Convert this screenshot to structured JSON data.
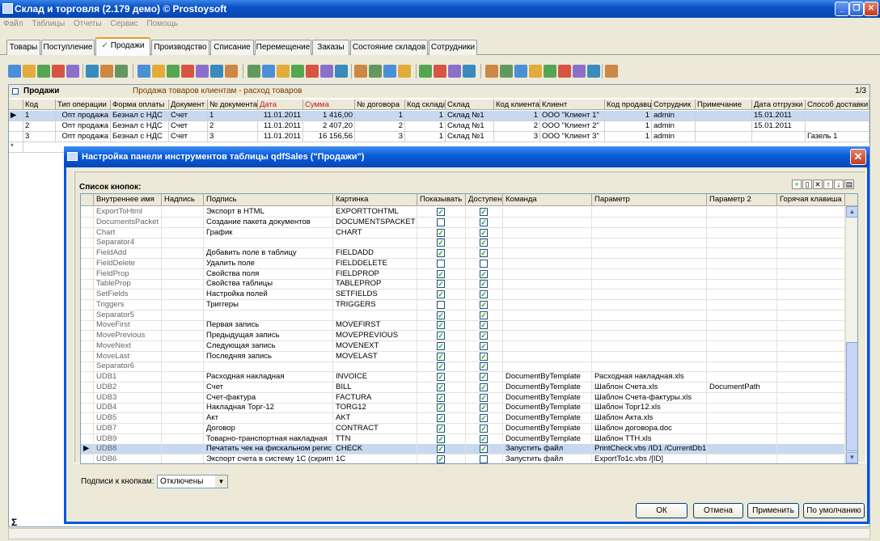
{
  "window": {
    "title": "Склад и торговля (2.179 демо) © Prostoysoft"
  },
  "menu": [
    "Файл",
    "Таблицы",
    "Отчеты",
    "Сервис",
    "Помощь"
  ],
  "tabs": [
    "Товары",
    "Поступление",
    "Продажи",
    "Производство",
    "Списание",
    "Перемещение",
    "Заказы",
    "Состояние складов",
    "Сотрудники"
  ],
  "active_tab_mark": "✓",
  "panel": {
    "title": "Продажи",
    "description": "Продажа товаров клиентам - расход товаров",
    "page": "1/3"
  },
  "main_table": {
    "columns": [
      "Код",
      "Тип операции",
      "Форма оплаты",
      "Документ",
      "№ документа",
      "Дата",
      "Сумма",
      "№ договора",
      "Код склада",
      "Склад",
      "Код клиента",
      "Клиент",
      "Код продавца",
      "Сотрудник",
      "Примечание",
      "Дата отгрузки",
      "Способ доставки"
    ],
    "rows": [
      [
        "1",
        "Опт продажа",
        "Безнал с НДС",
        "Счет",
        "1",
        "11.01.2011",
        "1 416,00",
        "1",
        "1",
        "Склад №1",
        "1",
        "ООО \"Клиент 1\"",
        "1",
        "admin",
        "",
        "15.01.2011",
        ""
      ],
      [
        "2",
        "Опт продажа",
        "Безнал с НДС",
        "Счет",
        "2",
        "11.01.2011",
        "2 407,20",
        "2",
        "1",
        "Склад №1",
        "2",
        "ООО \"Клиент 2\"",
        "1",
        "admin",
        "",
        "15.01.2011",
        ""
      ],
      [
        "3",
        "Опт продажа",
        "Безнал с НДС",
        "Счет",
        "3",
        "11.01.2011",
        "16 156,56",
        "3",
        "1",
        "Склад №1",
        "3",
        "ООО \"Клиент 3\"",
        "1",
        "admin",
        "",
        "",
        "Газель 1"
      ]
    ],
    "new_row_marker": "*",
    "sum_marker": "Σ"
  },
  "dialog": {
    "title": "Настройка панели инструментов таблицы qdfSales (\"Продажи\")",
    "list_label": "Список кнопок:",
    "columns": [
      "Внутреннее имя",
      "Надпись",
      "Подпись",
      "Картинка",
      "Показывать",
      "Доступен",
      "Команда",
      "Параметр",
      "Параметр 2",
      "Горячая клавиша"
    ],
    "rows": [
      {
        "name": "ExportToHtml",
        "caption": "",
        "hint": "Экспорт в HTML",
        "image": "EXPORTTOHTML",
        "show": true,
        "enabled": true,
        "command": "",
        "param": "",
        "param2": ""
      },
      {
        "name": "DocumentsPacket",
        "caption": "",
        "hint": "Создание пакета документов",
        "image": "DOCUMENTSPACKET",
        "show": false,
        "enabled": true,
        "command": "",
        "param": "",
        "param2": ""
      },
      {
        "name": "Chart",
        "caption": "",
        "hint": "График",
        "image": "CHART",
        "show": true,
        "enabled": true,
        "command": "",
        "param": "",
        "param2": ""
      },
      {
        "name": "Separator4",
        "caption": "",
        "hint": "",
        "image": "",
        "show": true,
        "enabled": true,
        "command": "",
        "param": "",
        "param2": ""
      },
      {
        "name": "FieldAdd",
        "caption": "",
        "hint": "Добавить поле в таблицу",
        "image": "FIELDADD",
        "show": true,
        "enabled": true,
        "command": "",
        "param": "",
        "param2": ""
      },
      {
        "name": "FieldDelete",
        "caption": "",
        "hint": "Удалить поле",
        "image": "FIELDDELETE",
        "show": false,
        "enabled": false,
        "command": "",
        "param": "",
        "param2": ""
      },
      {
        "name": "FieldProp",
        "caption": "",
        "hint": "Свойства поля",
        "image": "FIELDPROP",
        "show": true,
        "enabled": true,
        "command": "",
        "param": "",
        "param2": ""
      },
      {
        "name": "TableProp",
        "caption": "",
        "hint": "Свойства таблицы",
        "image": "TABLEPROP",
        "show": true,
        "enabled": true,
        "command": "",
        "param": "",
        "param2": ""
      },
      {
        "name": "SetFields",
        "caption": "",
        "hint": "Настройка полей",
        "image": "SETFIELDS",
        "show": true,
        "enabled": true,
        "command": "",
        "param": "",
        "param2": ""
      },
      {
        "name": "Triggers",
        "caption": "",
        "hint": "Триггеры",
        "image": "TRIGGERS",
        "show": false,
        "enabled": true,
        "command": "",
        "param": "",
        "param2": ""
      },
      {
        "name": "Separator5",
        "caption": "",
        "hint": "",
        "image": "",
        "show": true,
        "enabled": true,
        "command": "",
        "param": "",
        "param2": ""
      },
      {
        "name": "MoveFirst",
        "caption": "",
        "hint": "Первая запись",
        "image": "MOVEFIRST",
        "show": true,
        "enabled": true,
        "command": "",
        "param": "",
        "param2": ""
      },
      {
        "name": "MovePrevious",
        "caption": "",
        "hint": "Предыдущая запись",
        "image": "MOVEPREVIOUS",
        "show": true,
        "enabled": true,
        "command": "",
        "param": "",
        "param2": ""
      },
      {
        "name": "MoveNext",
        "caption": "",
        "hint": "Следующая запись",
        "image": "MOVENEXT",
        "show": true,
        "enabled": true,
        "command": "",
        "param": "",
        "param2": ""
      },
      {
        "name": "MoveLast",
        "caption": "",
        "hint": "Последняя запись",
        "image": "MOVELAST",
        "show": true,
        "enabled": true,
        "command": "",
        "param": "",
        "param2": ""
      },
      {
        "name": "Separator6",
        "caption": "",
        "hint": "",
        "image": "",
        "show": true,
        "enabled": true,
        "command": "",
        "param": "",
        "param2": ""
      },
      {
        "name": "UDB1",
        "caption": "",
        "hint": "Расходная накладная",
        "image": "INVOICE",
        "show": true,
        "enabled": true,
        "command": "DocumentByTemplate",
        "param": "Расходная накладная.xls",
        "param2": ""
      },
      {
        "name": "UDB2",
        "caption": "",
        "hint": "Счет",
        "image": "BILL",
        "show": true,
        "enabled": true,
        "command": "DocumentByTemplate",
        "param": "Шаблон Счета.xls",
        "param2": "DocumentPath"
      },
      {
        "name": "UDB3",
        "caption": "",
        "hint": "Счет-фактура",
        "image": "FACTURA",
        "show": true,
        "enabled": true,
        "command": "DocumentByTemplate",
        "param": "Шаблон Счета-фактуры.xls",
        "param2": ""
      },
      {
        "name": "UDB4",
        "caption": "",
        "hint": "Накладная Торг-12",
        "image": "TORG12",
        "show": true,
        "enabled": true,
        "command": "DocumentByTemplate",
        "param": "Шаблон Торг12.xls",
        "param2": ""
      },
      {
        "name": "UDB5",
        "caption": "",
        "hint": "Акт",
        "image": "AKT",
        "show": true,
        "enabled": true,
        "command": "DocumentByTemplate",
        "param": "Шаблон Акта.xls",
        "param2": ""
      },
      {
        "name": "UDB7",
        "caption": "",
        "hint": "Договор",
        "image": "CONTRACT",
        "show": true,
        "enabled": true,
        "command": "DocumentByTemplate",
        "param": "Шаблон договора.doc",
        "param2": ""
      },
      {
        "name": "UDB9",
        "caption": "",
        "hint": "Товарно-транспортная накладная",
        "image": "TTN",
        "show": true,
        "enabled": true,
        "command": "DocumentByTemplate",
        "param": "Шаблон ТТН.xls",
        "param2": ""
      },
      {
        "name": "UDB8",
        "caption": "",
        "hint": "Печатать чек на фискальном регис",
        "image": "CHECK",
        "show": true,
        "enabled": true,
        "command": "Запустить файл",
        "param": "PrintCheck.vbs /ID1 /CurrentDb1",
        "param2": ""
      },
      {
        "name": "UDB6",
        "caption": "",
        "hint": "Экспорт счета в систему 1С (скрипт",
        "image": "1C",
        "show": true,
        "enabled": false,
        "command": "Запустить файл",
        "param": "ExportTo1c.vbs /[ID]",
        "param2": ""
      }
    ],
    "selected_row_marker": "▶",
    "captions_label": "Подписи к кнопкам:",
    "captions_value": "Отключены",
    "buttons": {
      "ok": "ОК",
      "cancel": "Отмена",
      "apply": "Применить",
      "default": "По умолчанию"
    }
  },
  "toolbar_icons": [
    "add-icon",
    "edit-icon",
    "copy-icon",
    "delete-icon",
    "delete-all-icon",
    "filter-icon",
    "filter-set-icon",
    "filter-clear-icon",
    "refresh-icon",
    "tree-icon",
    "filter-field-icon",
    "sql-icon",
    "find-icon",
    "print-icon",
    "preview-icon",
    "export-icon",
    "excel-icon",
    "word-icon",
    "xml-icon",
    "html-icon",
    "packet-icon",
    "chart-icon",
    "field-add-icon",
    "field-delete-icon",
    "field-prop-icon",
    "table-prop-icon",
    "first-icon",
    "prev-icon",
    "next-icon",
    "last-icon",
    "invoice-icon",
    "bill-icon",
    "factura-icon",
    "torg12-icon",
    "akt-icon",
    "contract-icon",
    "ttn-icon",
    "check-icon",
    "1c-icon"
  ],
  "colors": {
    "accent": "#0054e3",
    "tab_active": "#e69a2e",
    "selection": "#c7d9f1",
    "checkmark": "#21a121"
  }
}
